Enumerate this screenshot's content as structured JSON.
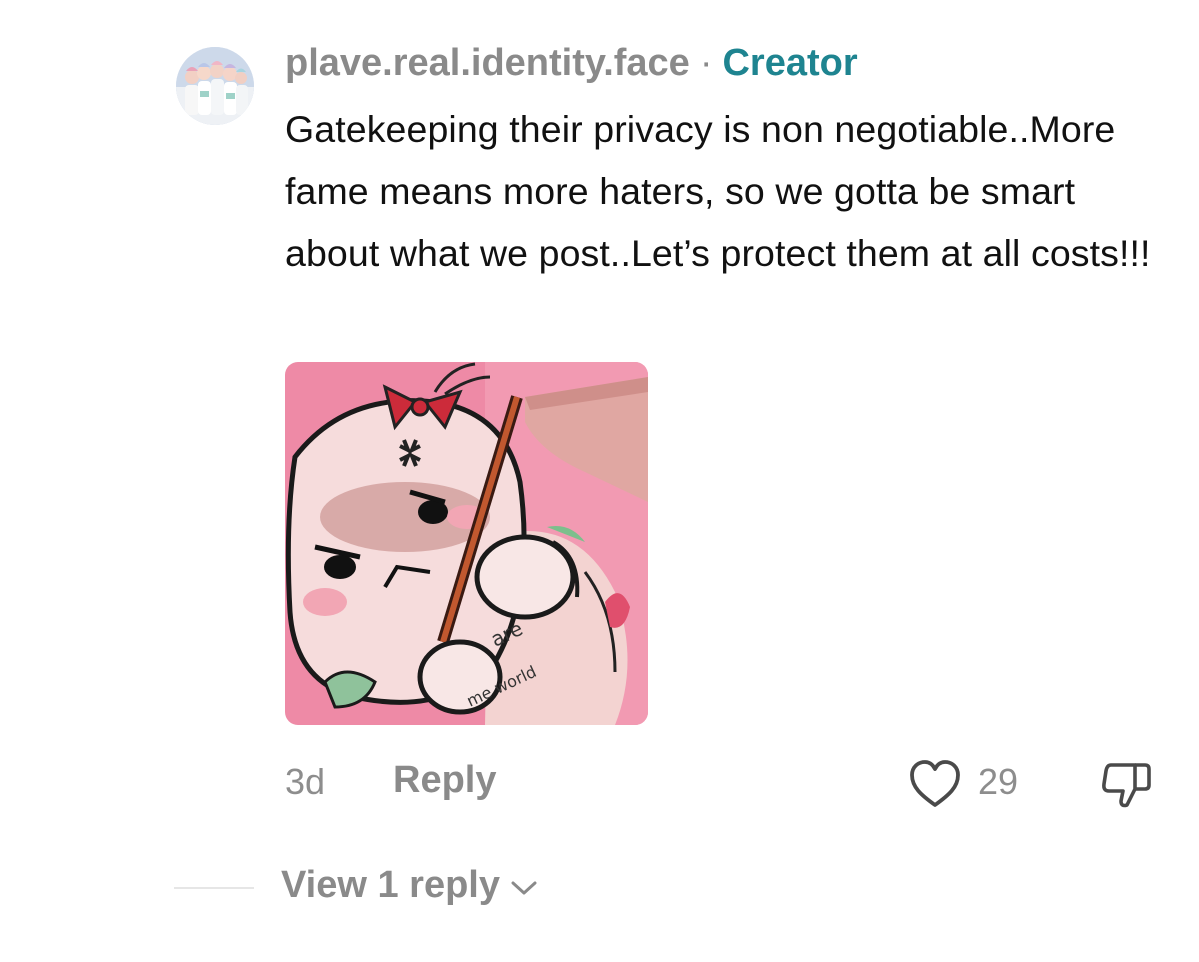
{
  "comment": {
    "username": "plave.real.identity.face",
    "separator": "·",
    "creator_label": "Creator",
    "text": "Gatekeeping their privacy is non negotiable..More fame means more haters, so we gotta be smart about what we post..Let’s protect them at all costs!!!",
    "sticker": {
      "caption_line_1": "are",
      "caption_line_2": "me world"
    },
    "timestamp": "3d",
    "reply_label": "Reply",
    "like_count": "29",
    "icons": {
      "like": "heart-outline-icon",
      "dislike": "thumbs-down-outline-icon",
      "expand": "chevron-down-icon"
    }
  },
  "replies": {
    "label": "View 1 reply"
  },
  "colors": {
    "username": "#8a8a8a",
    "creator": "#1e8490",
    "text": "#111111",
    "muted": "#8d8d8d",
    "sticker_bg": "#ee8aa6"
  }
}
